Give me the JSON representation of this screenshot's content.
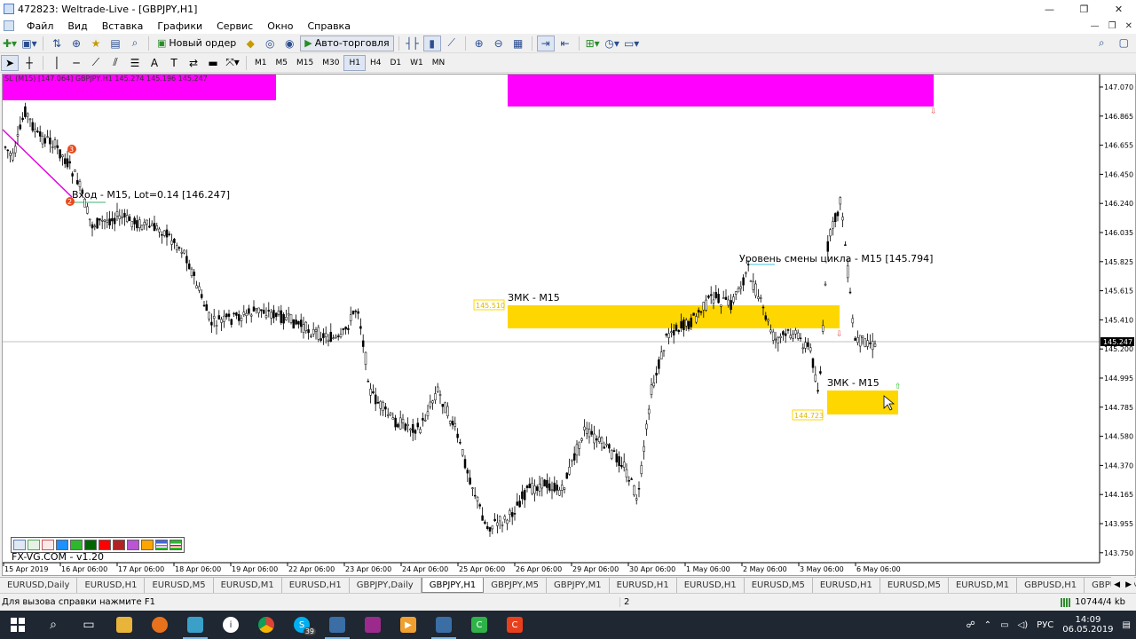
{
  "window": {
    "title": "472823: Weltrade-Live - [GBPJPY,H1]",
    "minimize": "—",
    "maximize": "❐",
    "close": "✕"
  },
  "menu": [
    "Файл",
    "Вид",
    "Вставка",
    "Графики",
    "Сервис",
    "Окно",
    "Справка"
  ],
  "toolbar": {
    "new_order_label": "Новый ордер",
    "autotrading_label": "Авто-торговля",
    "timeframes": [
      "M1",
      "M5",
      "M15",
      "M30",
      "H1",
      "H4",
      "D1",
      "W1",
      "MN"
    ],
    "active_timeframe": "H1"
  },
  "chart": {
    "top_left_text": "SL (M15) [147.064] GBPJPY,H1 145.274 145.196 145.247",
    "price_ticks": [
      "147.070",
      "146.865",
      "146.655",
      "146.450",
      "146.240",
      "146.035",
      "145.825",
      "145.615",
      "145.410",
      "145.200",
      "144.995",
      "144.785",
      "144.580",
      "144.370",
      "144.165",
      "143.955",
      "143.750"
    ],
    "current_price": "145.247",
    "time_ticks": [
      "15 Apr 2019",
      "16 Apr 06:00",
      "17 Apr 06:00",
      "18 Apr 06:00",
      "19 Apr 06:00",
      "22 Apr 06:00",
      "23 Apr 06:00",
      "24 Apr 06:00",
      "25 Apr 06:00",
      "26 Apr 06:00",
      "29 Apr 06:00",
      "30 Apr 06:00",
      "1 May 06:00",
      "2 May 06:00",
      "3 May 06:00",
      "6 May 06:00"
    ],
    "annotations": {
      "entry": "Вход - M15, Lot=0.14 [146.247]",
      "cycle_level": "Уровень смены цикла - M15 [145.794]",
      "zmk1": "ЗМК - M15",
      "zmk1_price": "145.510",
      "zmk2": "ЗМК - M15",
      "zmk2_price": "144.723",
      "marker_3": "3",
      "marker_2": "2"
    },
    "colors": {
      "magenta_zone": "#ff00ff",
      "yellow_zone": "#ffd700",
      "candle": "#000000"
    }
  },
  "palette_colors": [
    "#ffffff",
    "#ffffff",
    "#ffffff",
    "#1e90ff",
    "#2db82d",
    "#006400",
    "#ff0000",
    "#b22222",
    "#ba55d3",
    "#ffa500",
    "#4169e1"
  ],
  "brand_text": "FX-VG.COM - v1.20",
  "tabs": [
    "EURUSD,Daily",
    "EURUSD,H1",
    "EURUSD,M5",
    "EURUSD,M1",
    "EURUSD,H1",
    "GBPJPY,Daily",
    "GBPJPY,H1",
    "GBPJPY,M5",
    "GBPJPY,M1",
    "EURUSD,H1",
    "EURUSD,H1",
    "EURUSD,M5",
    "EURUSD,H1",
    "EURUSD,M5",
    "EURUSD,M1",
    "GBPUSD,H1",
    "GBPUSD,M5",
    "GBPUSD"
  ],
  "active_tab_index": 6,
  "status": {
    "help_text": "Для вызова справки нажмите F1",
    "page_num": "2",
    "traffic": "10744/4 kb"
  },
  "taskbar": {
    "notification_count": "39",
    "language": "РУС",
    "time": "14:09",
    "date": "06.05.2019"
  }
}
